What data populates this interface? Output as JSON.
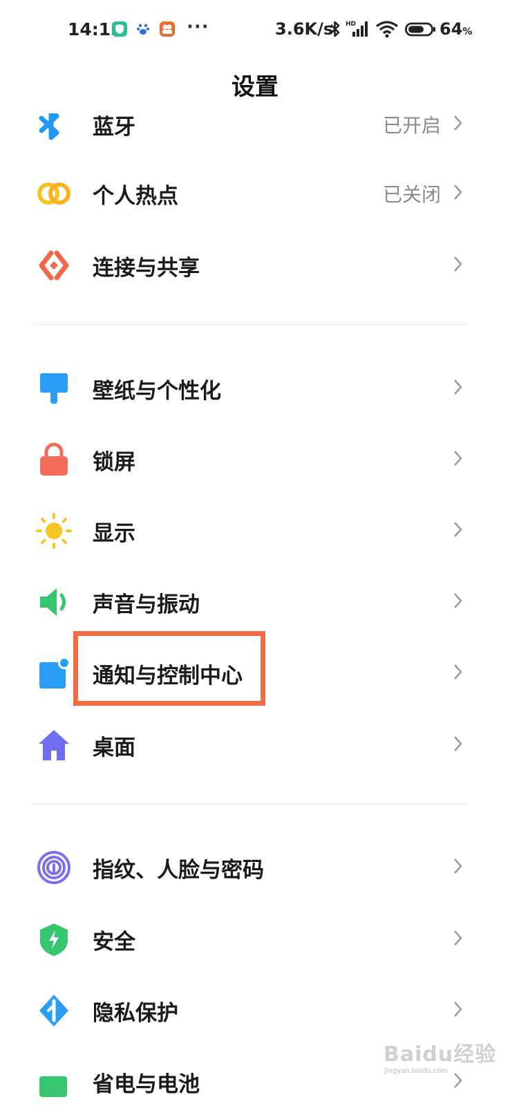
{
  "status_bar": {
    "time": "14:15",
    "more": "···",
    "net_speed": "3.6K/s",
    "battery_pct": "64",
    "battery_unit": "%",
    "icons": [
      "shield-app-icon",
      "baidu-app-icon",
      "video-app-icon",
      "bluetooth-icon",
      "hd-signal-icon",
      "wifi-icon",
      "battery-icon"
    ]
  },
  "header": {
    "title": "设置"
  },
  "sections": [
    {
      "items": [
        {
          "label": "蓝牙",
          "status": "已开启",
          "icon": "bluetooth-icon",
          "color": "#1e9af5"
        },
        {
          "label": "个人热点",
          "status": "已关闭",
          "icon": "hotspot-icon",
          "color": "#f5c424"
        },
        {
          "label": "连接与共享",
          "status": "",
          "icon": "connection-share-icon",
          "color": "#f0684a"
        }
      ]
    },
    {
      "items": [
        {
          "label": "壁纸与个性化",
          "status": "",
          "icon": "paint-brush-icon",
          "color": "#2a9df4"
        },
        {
          "label": "锁屏",
          "status": "",
          "icon": "lock-icon",
          "color": "#f26e5a"
        },
        {
          "label": "显示",
          "status": "",
          "icon": "sun-icon",
          "color": "#f8c526"
        },
        {
          "label": "声音与振动",
          "status": "",
          "icon": "speaker-icon",
          "color": "#35c66f"
        },
        {
          "label": "通知与控制中心",
          "status": "",
          "icon": "notification-icon",
          "color": "#2a9df4"
        },
        {
          "label": "桌面",
          "status": "",
          "icon": "home-icon",
          "color": "#6f6ff0"
        }
      ]
    },
    {
      "items": [
        {
          "label": "指纹、人脸与密码",
          "status": "",
          "icon": "fingerprint-icon",
          "color": "#7a70ea"
        },
        {
          "label": "安全",
          "status": "",
          "icon": "security-shield-icon",
          "color": "#35c66f"
        },
        {
          "label": "隐私保护",
          "status": "",
          "icon": "privacy-icon",
          "color": "#2a9df4"
        },
        {
          "label": "省电与电池",
          "status": "",
          "icon": "battery-saver-icon",
          "color": "#35c66f"
        }
      ]
    }
  ],
  "watermark": {
    "text": "Baidu经验",
    "sub": "jingyan.baidu.com"
  }
}
